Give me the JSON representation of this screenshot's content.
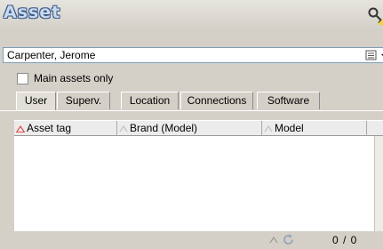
{
  "window": {
    "title": "Asset"
  },
  "icons": {
    "key": "key-icon",
    "refresh": "refresh-icon",
    "sort": "sort-arrow-icon",
    "dropdown": "chevron-down-icon"
  },
  "user_select": {
    "value": "Carpenter, Jerome"
  },
  "filter": {
    "main_assets_only_label": "Main assets only",
    "checked": false
  },
  "tabs": [
    {
      "label": "User",
      "active": true
    },
    {
      "label": "Superv.",
      "active": false
    },
    {
      "label": "Location",
      "active": false
    },
    {
      "label": "Connections",
      "active": false
    },
    {
      "label": "Software",
      "active": false
    }
  ],
  "grid": {
    "columns": [
      {
        "label": "Asset tag",
        "sorted": true
      },
      {
        "label": "Brand (Model)",
        "sorted": false
      },
      {
        "label": "Model",
        "sorted": false
      }
    ],
    "rows": [],
    "counter": "0 / 0"
  },
  "colors": {
    "sort_active": "#e05050",
    "sort_inactive": "#c4c2bc",
    "title_fill": "#c9dbee",
    "title_outline": "#3d5a8a"
  }
}
